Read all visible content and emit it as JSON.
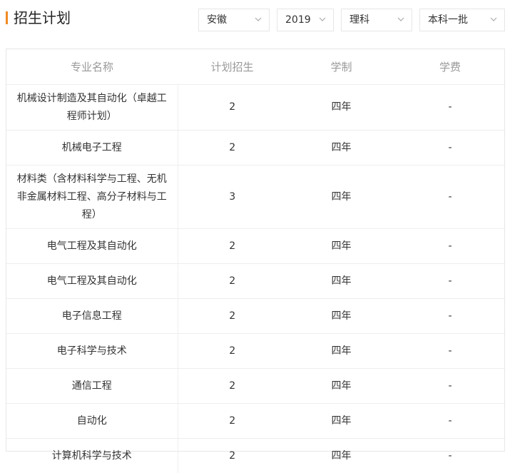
{
  "header": {
    "title": "招生计划",
    "filters": [
      {
        "name": "province",
        "value": "安徽"
      },
      {
        "name": "year",
        "value": "2019"
      },
      {
        "name": "subject",
        "value": "理科"
      },
      {
        "name": "batch",
        "value": "本科一批"
      }
    ],
    "accent_color": "#f08a24"
  },
  "table": {
    "columns": [
      "专业名称",
      "计划招生",
      "学制",
      "学费"
    ],
    "rows": [
      {
        "major": "机械设计制造及其自动化（卓越工程师计划）",
        "plan": "2",
        "duration": "四年",
        "fee": "-"
      },
      {
        "major": "机械电子工程",
        "plan": "2",
        "duration": "四年",
        "fee": "-"
      },
      {
        "major": "材料类（含材料科学与工程、无机非金属材料工程、高分子材料与工程）",
        "plan": "3",
        "duration": "四年",
        "fee": "-"
      },
      {
        "major": "电气工程及其自动化",
        "plan": "2",
        "duration": "四年",
        "fee": "-"
      },
      {
        "major": "电气工程及其自动化",
        "plan": "2",
        "duration": "四年",
        "fee": "-"
      },
      {
        "major": "电子信息工程",
        "plan": "2",
        "duration": "四年",
        "fee": "-"
      },
      {
        "major": "电子科学与技术",
        "plan": "2",
        "duration": "四年",
        "fee": "-"
      },
      {
        "major": "通信工程",
        "plan": "2",
        "duration": "四年",
        "fee": "-"
      },
      {
        "major": "自动化",
        "plan": "2",
        "duration": "四年",
        "fee": "-"
      },
      {
        "major": "计算机科学与技术",
        "plan": "2",
        "duration": "四年",
        "fee": "-"
      }
    ]
  }
}
